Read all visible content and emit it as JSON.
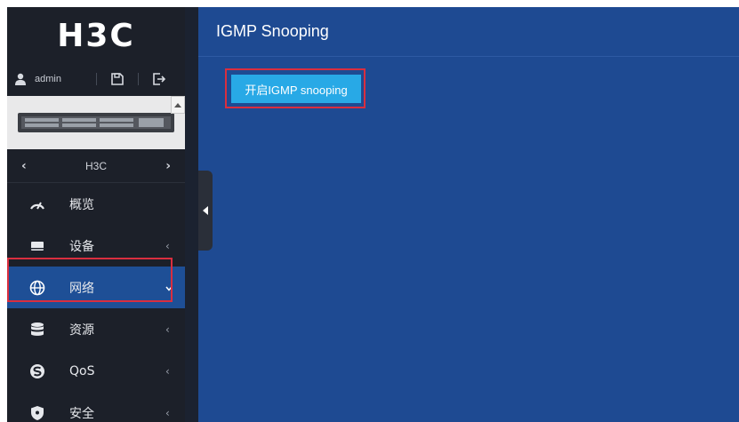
{
  "logo": "H3C",
  "user": {
    "name": "admin"
  },
  "device_selector": {
    "name": "H3C"
  },
  "menu": [
    {
      "label": "概览",
      "icon": "dashboard-icon",
      "has_submenu": false
    },
    {
      "label": "设备",
      "icon": "device-icon",
      "has_submenu": true,
      "expanded": false
    },
    {
      "label": "网络",
      "icon": "globe-icon",
      "has_submenu": true,
      "expanded": true,
      "active": true
    },
    {
      "label": "资源",
      "icon": "database-icon",
      "has_submenu": true,
      "expanded": false
    },
    {
      "label": "QoS",
      "icon": "qos-icon",
      "has_submenu": true,
      "expanded": false
    },
    {
      "label": "安全",
      "icon": "shield-icon",
      "has_submenu": true,
      "expanded": false
    }
  ],
  "main": {
    "title": "IGMP Snooping",
    "enable_button": "开启IGMP snooping"
  },
  "colors": {
    "sidebar_bg": "#1c2029",
    "main_bg": "#1e4a92",
    "active_item": "#1e4f96",
    "button": "#28a9e6",
    "highlight": "#d92e3f"
  }
}
